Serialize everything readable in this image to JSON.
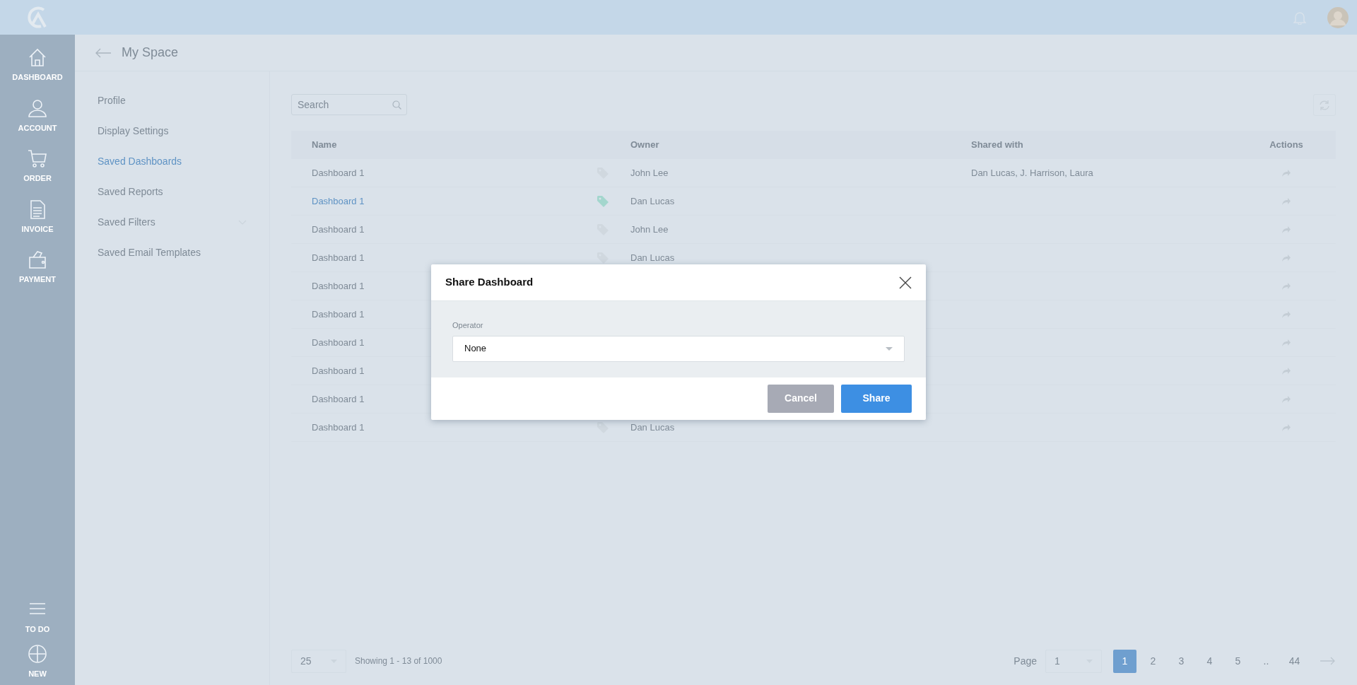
{
  "nav": {
    "items": [
      {
        "label": "DASHBOARD"
      },
      {
        "label": "ACCOUNT"
      },
      {
        "label": "ORDER"
      },
      {
        "label": "INVOICE"
      },
      {
        "label": "PAYMENT"
      }
    ],
    "bottom_items": [
      {
        "label": "TO DO"
      },
      {
        "label": "NEW"
      }
    ]
  },
  "header": {
    "title": "My Space"
  },
  "sidebar": {
    "items": [
      {
        "label": "Profile",
        "selected": false
      },
      {
        "label": "Display Settings",
        "selected": false
      },
      {
        "label": "Saved Dashboards",
        "selected": true
      },
      {
        "label": "Saved Reports",
        "selected": false
      },
      {
        "label": "Saved Filters",
        "selected": false,
        "expanded": false
      },
      {
        "label": "Saved Email Templates",
        "selected": false
      }
    ]
  },
  "search": {
    "placeholder": "Search"
  },
  "table": {
    "columns": [
      "Name",
      "Owner",
      "Shared with",
      "Actions"
    ],
    "rows": [
      {
        "name": "Dashboard 1",
        "owner": "John Lee",
        "shared_with": "Dan Lucas,  J. Harrison, Laura",
        "selected": false
      },
      {
        "name": "Dashboard 1",
        "owner": "Dan Lucas",
        "selected": true
      },
      {
        "name": "Dashboard 1",
        "owner": "John Lee",
        "selected": false
      },
      {
        "name": "Dashboard 1",
        "owner": "Dan Lucas",
        "selected": false
      },
      {
        "name": "Dashboard 1",
        "selected": false
      },
      {
        "name": "Dashboard 1",
        "selected": false
      },
      {
        "name": "Dashboard 1",
        "selected": false
      },
      {
        "name": "Dashboard 1",
        "selected": false
      },
      {
        "name": "Dashboard 1",
        "selected": false
      },
      {
        "name": "Dashboard 1",
        "owner": "Dan Lucas",
        "selected": false
      }
    ]
  },
  "pagination": {
    "per_page": "25",
    "summary": "Showing 1 - 13 of 1000",
    "page_label": "Page",
    "page_select": "1",
    "pages": [
      {
        "label": "1",
        "selected": true
      },
      {
        "label": "2",
        "selected": false
      },
      {
        "label": "3",
        "selected": false
      },
      {
        "label": "4",
        "selected": false
      },
      {
        "label": "5",
        "selected": false
      },
      {
        "label": "..",
        "selected": false
      },
      {
        "label": "44",
        "selected": false
      }
    ]
  },
  "dialog": {
    "title": "Share Dashboard",
    "field_label": "Operator",
    "field_value": "None",
    "buttons": [
      {
        "label": "Cancel",
        "kind": "secondary"
      },
      {
        "label": "Share",
        "kind": "primary"
      }
    ]
  }
}
